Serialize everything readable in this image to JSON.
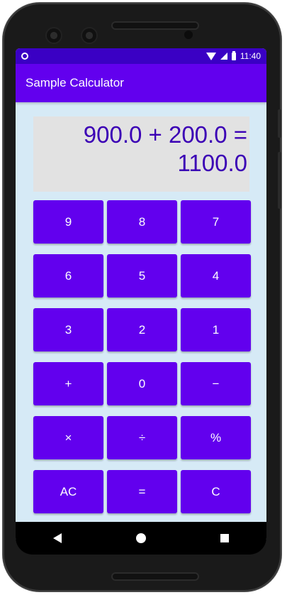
{
  "status_bar": {
    "time": "11:40"
  },
  "app_bar": {
    "title": "Sample Calculator"
  },
  "display": {
    "line1": "900.0 + 200.0 =",
    "line2": "1100.0"
  },
  "keys": [
    {
      "label": "9"
    },
    {
      "label": "8"
    },
    {
      "label": "7"
    },
    {
      "label": "6"
    },
    {
      "label": "5"
    },
    {
      "label": "4"
    },
    {
      "label": "3"
    },
    {
      "label": "2"
    },
    {
      "label": "1"
    },
    {
      "label": "+"
    },
    {
      "label": "0"
    },
    {
      "label": "−"
    },
    {
      "label": "×"
    },
    {
      "label": "÷"
    },
    {
      "label": "%"
    },
    {
      "label": "AC"
    },
    {
      "label": "="
    },
    {
      "label": "C"
    }
  ],
  "colors": {
    "accent": "#6200ee",
    "status_bar": "#3a00c4",
    "display_text": "#3b00b5",
    "background": "#d6eaf6"
  },
  "icons": {
    "status": [
      "notification-icon",
      "wifi-icon",
      "signal-icon",
      "battery-icon"
    ],
    "navigation": [
      "back-icon",
      "home-icon",
      "recents-icon"
    ]
  }
}
